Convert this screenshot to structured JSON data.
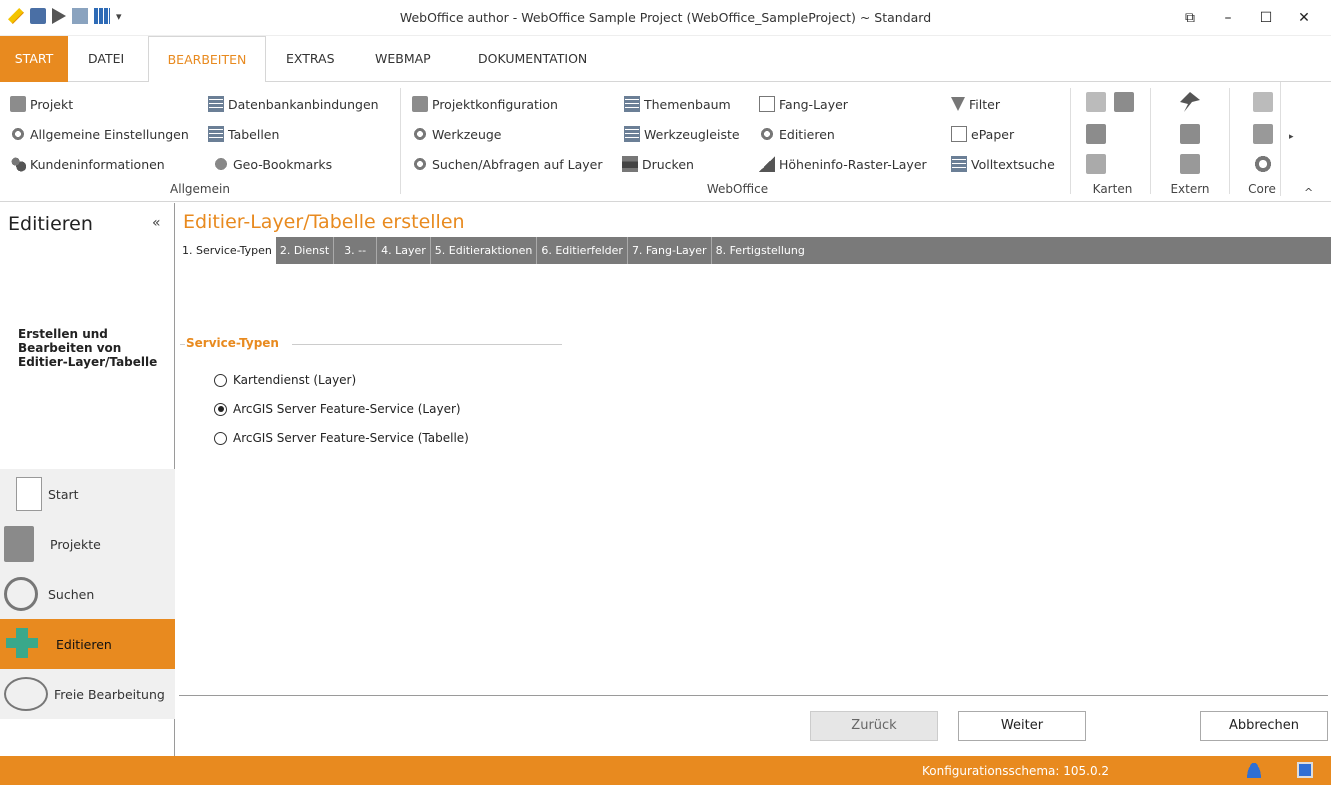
{
  "window": {
    "title": "WebOffice author - WebOffice Sample Project (WebOffice_SampleProject) ~ Standard",
    "controls": [
      "⧉",
      "–",
      "☐",
      "✕"
    ]
  },
  "menu_tabs": [
    {
      "label": "START"
    },
    {
      "label": "DATEI"
    },
    {
      "label": "BEARBEITEN"
    },
    {
      "label": "EXTRAS"
    },
    {
      "label": "WEBMAP"
    },
    {
      "label": "DOKUMENTATION"
    }
  ],
  "ribbon": {
    "allgemein": {
      "label": "Allgemein",
      "items": [
        "Projekt",
        "Allgemeine Einstellungen",
        "Kundeninformationen",
        "Datenbankanbindungen",
        "Tabellen",
        "Geo-Bookmarks"
      ]
    },
    "weboffice": {
      "label": "WebOffice",
      "items": [
        "Projektkonfiguration",
        "Werkzeuge",
        "Suchen/Abfragen auf Layer",
        "Themenbaum",
        "Werkzeugleiste",
        "Drucken",
        "Fang-Layer",
        "Editieren",
        "Höheninfo-Raster-Layer",
        "Filter",
        "ePaper",
        "Volltextsuche"
      ]
    },
    "karten": {
      "label": "Karten"
    },
    "extern": {
      "label": "Extern"
    },
    "core": {
      "label": "Core"
    },
    "scroll_glyph": "▸",
    "collapse_glyph": "^"
  },
  "left_panel": {
    "title": "Editieren",
    "collapse_glyph": "«",
    "description": "Erstellen und Bearbeiten von Editier-Layer/Tabelle",
    "nav": [
      {
        "label": "Start",
        "icon": "page-icon"
      },
      {
        "label": "Projekte",
        "icon": "notebook-icon"
      },
      {
        "label": "Suchen",
        "icon": "magnifier-icon"
      },
      {
        "label": "Editieren",
        "icon": "edit-arrows-icon",
        "active": true
      },
      {
        "label": "Freie Bearbeitung",
        "icon": "pen-icon"
      }
    ]
  },
  "main": {
    "title": "Editier-Layer/Tabelle erstellen",
    "steps": [
      "1. Service-Typen",
      "2. Dienst",
      "3. --",
      "4. Layer",
      "5. Editieraktionen",
      "6. Editierfelder",
      "7. Fang-Layer",
      "8. Fertigstellung"
    ],
    "active_step": 0,
    "fieldset_legend": "Service-Typen",
    "options": [
      {
        "label": "Kartendienst (Layer)",
        "checked": false
      },
      {
        "label": "ArcGIS Server Feature-Service (Layer)",
        "checked": true
      },
      {
        "label": "ArcGIS Server Feature-Service (Tabelle)",
        "checked": false
      }
    ],
    "buttons": {
      "back": "Zurück",
      "next": "Weiter",
      "cancel": "Abbrechen"
    }
  },
  "statusbar": {
    "text": "Konfigurationsschema: 105.0.2"
  },
  "colors": {
    "accent": "#e88a1f",
    "steps_bg": "#7a7a7a"
  }
}
